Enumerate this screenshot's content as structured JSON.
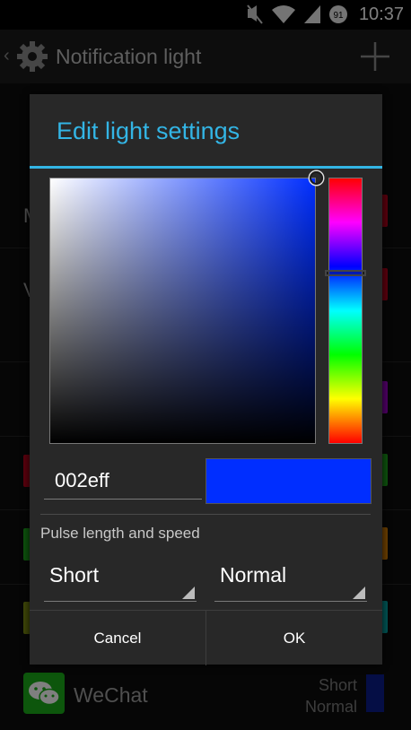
{
  "status_bar": {
    "time": "10:37",
    "battery_level": "91",
    "icons": [
      "mute-icon",
      "wifi-icon",
      "signal-icon",
      "battery-icon"
    ]
  },
  "action_bar": {
    "title": "Notification light",
    "icons": [
      "back-chevron-icon",
      "gear-icon",
      "add-icon"
    ]
  },
  "background_list": {
    "partial_letters": [
      "M",
      "V"
    ],
    "wechat": {
      "name": "WeChat",
      "length": "Short",
      "speed": "Normal",
      "color": "#0a1d8a"
    }
  },
  "dialog": {
    "title": "Edit light settings",
    "accent_color": "#33b5e5",
    "color_picker": {
      "hex_value": "002eff",
      "preview_color": "#002eff"
    },
    "pulse_label": "Pulse length and speed",
    "length_spinner": {
      "selected": "Short"
    },
    "speed_spinner": {
      "selected": "Normal"
    },
    "buttons": {
      "cancel": "Cancel",
      "ok": "OK"
    }
  }
}
